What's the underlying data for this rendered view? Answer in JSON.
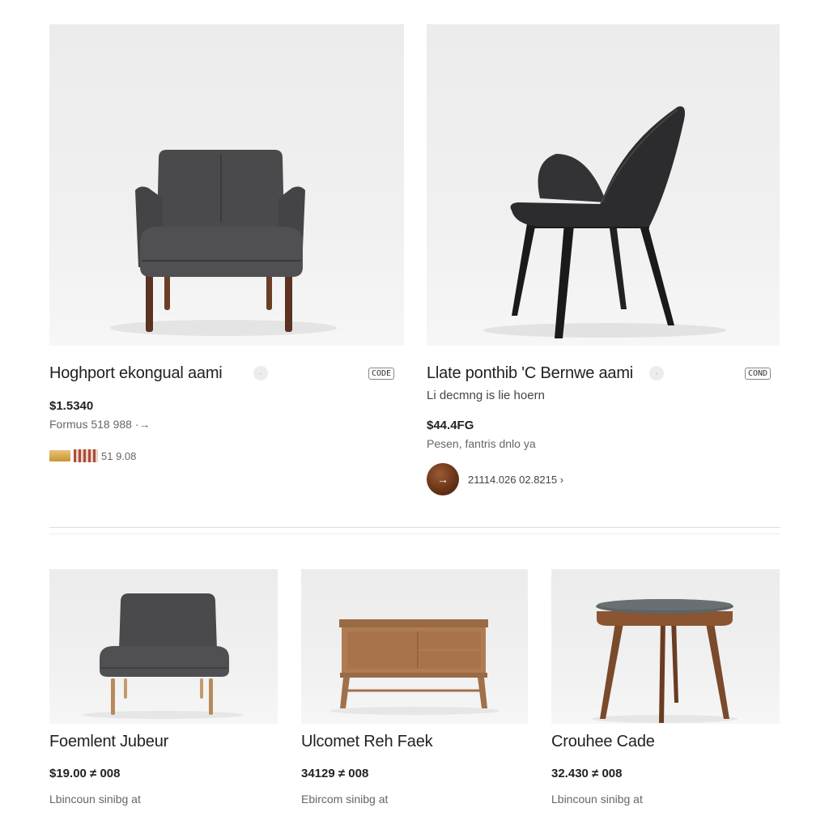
{
  "products_top": [
    {
      "title": "Hoghport ekongual aami",
      "chip": "·",
      "badge": "CODE",
      "price": "$1.5340",
      "meta": "Formus 518 988 ·→",
      "rating_text": "51 9.08"
    },
    {
      "title": "Llate ponthib 'C Bernwe aami",
      "chip": "·",
      "badge": "COND",
      "subtitle": "Li decmng is lie hoern",
      "price": "$44.4FG",
      "meta": "Pesen, fantris dnlo ya",
      "avatar_glyph": "→",
      "seller_text": "21114.026 02.8215 ›"
    }
  ],
  "products_bottom": [
    {
      "title": "Foemlent Jubeur",
      "price": "$19.00 ≠ 008",
      "meta": "Lbincoun sinibg at"
    },
    {
      "title": "Ulcomet Reh Faek",
      "price": "34129 ≠ 008",
      "meta": "Ebircom sinibg at"
    },
    {
      "title": "Crouhee Cade",
      "price": "32.430 ≠ 008",
      "meta": "Lbincoun sinibg at"
    }
  ]
}
